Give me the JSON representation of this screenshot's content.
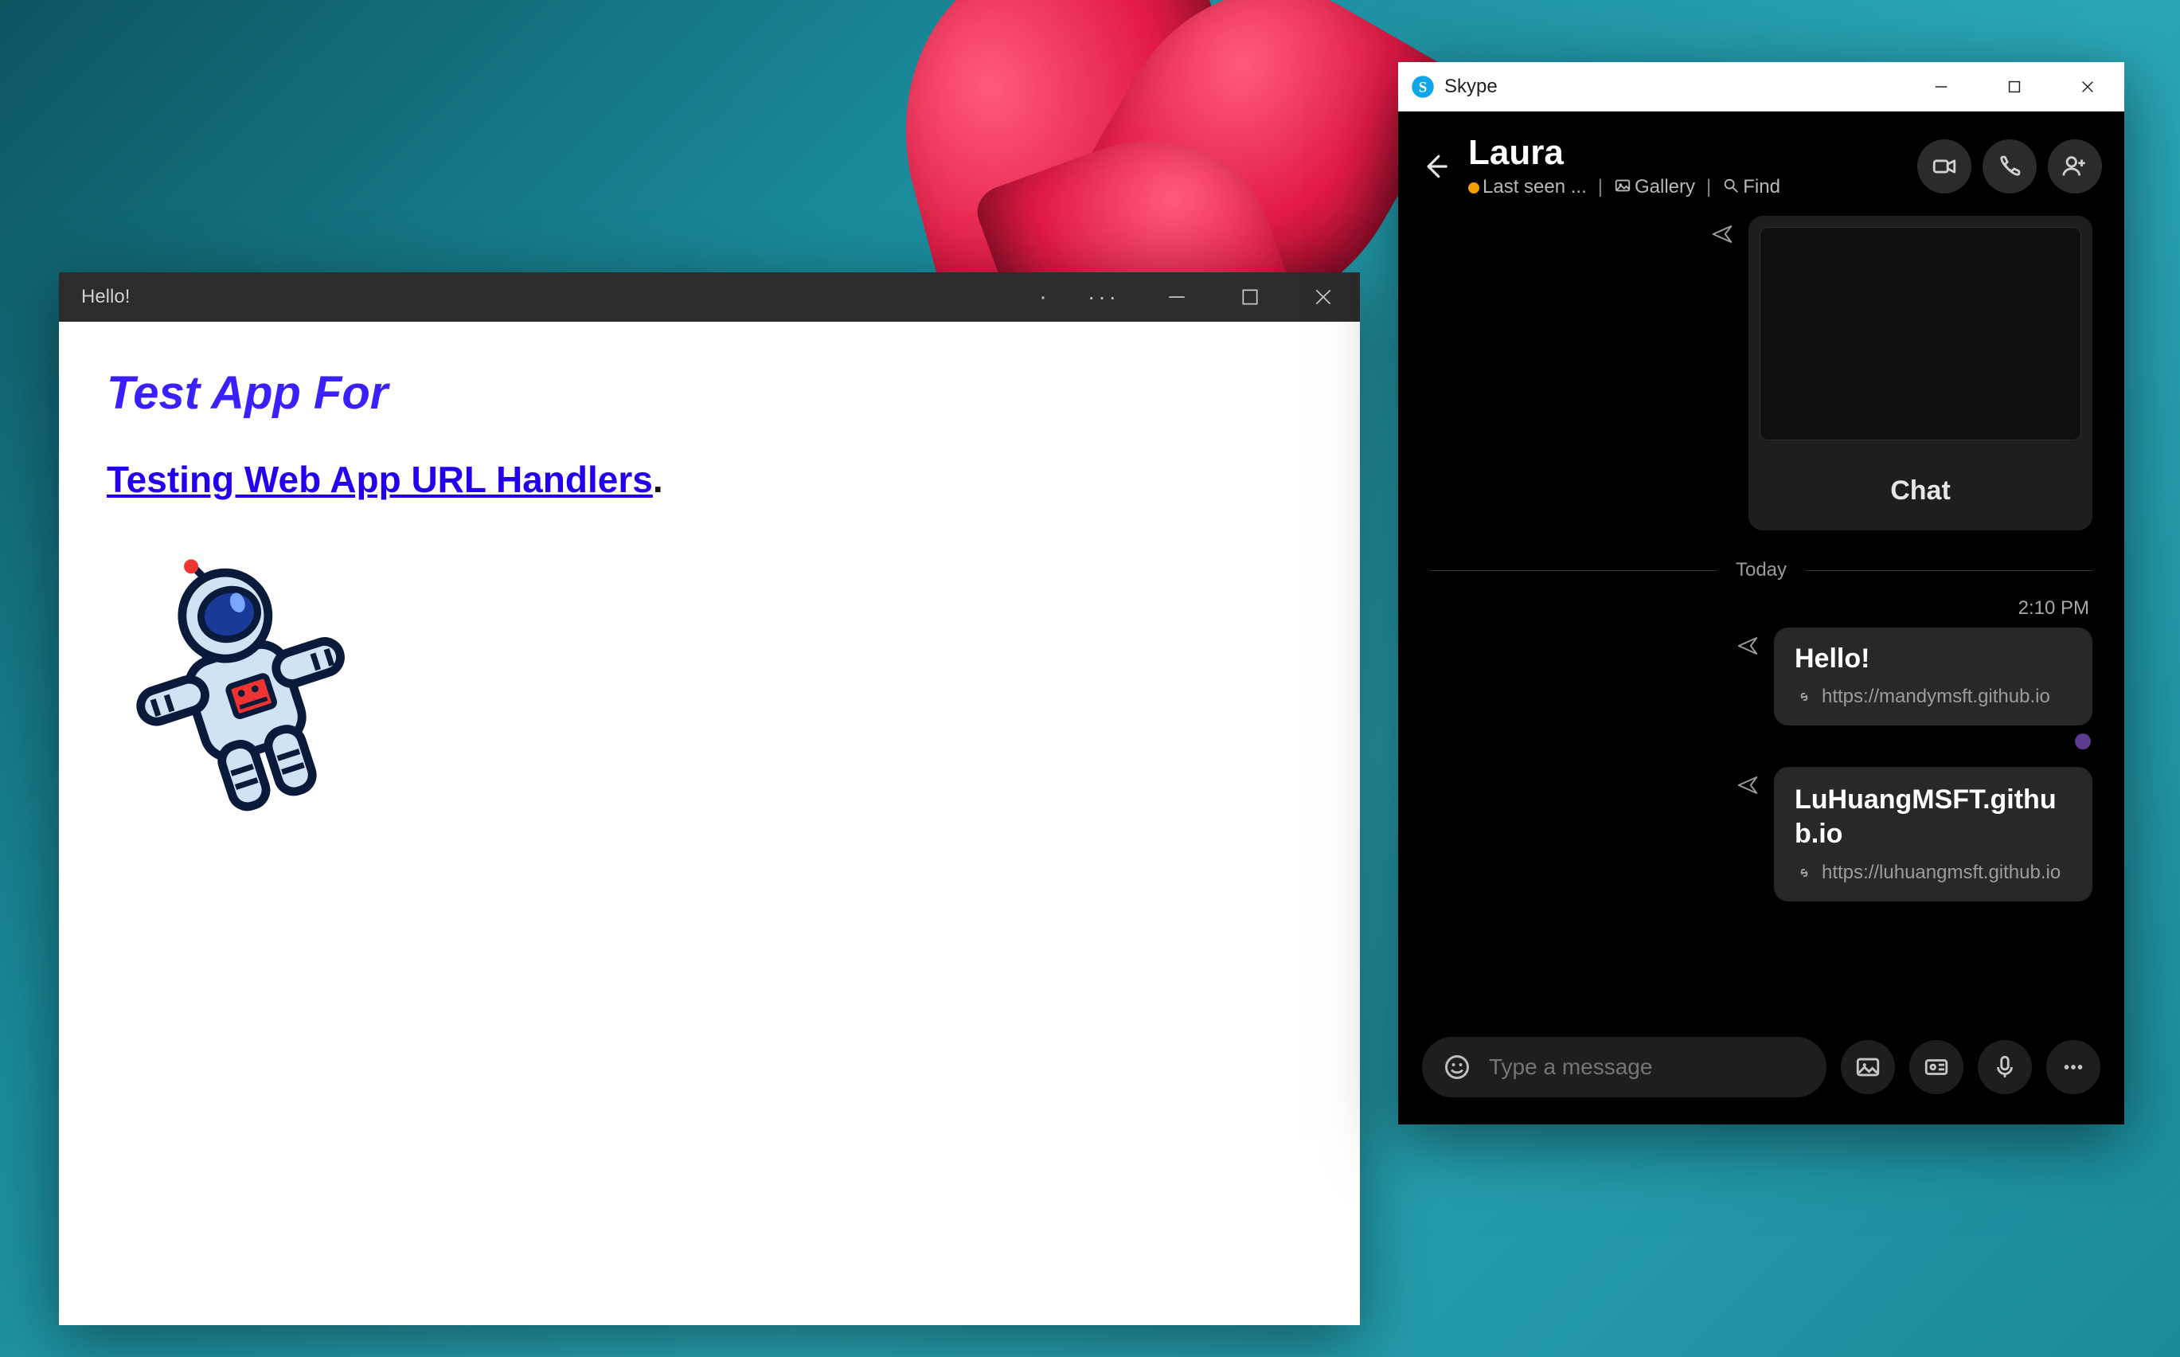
{
  "helloWindow": {
    "title": "Hello!",
    "heading": "Test App For",
    "linkText": "Testing Web App URL Handlers",
    "period": "."
  },
  "skype": {
    "appName": "Skype",
    "contactName": "Laura",
    "lastSeen": "Last seen ...",
    "galleryLabel": "Gallery",
    "findLabel": "Find",
    "chatCardButton": "Chat",
    "dayLabel": "Today",
    "timestamp": "2:10 PM",
    "messages": [
      {
        "title": "Hello!",
        "url": "https://mandymsft.github.io"
      },
      {
        "title": "LuHuangMSFT.github.io",
        "url": "https://luhuangmsft.github.io"
      }
    ],
    "composerPlaceholder": "Type a message"
  }
}
